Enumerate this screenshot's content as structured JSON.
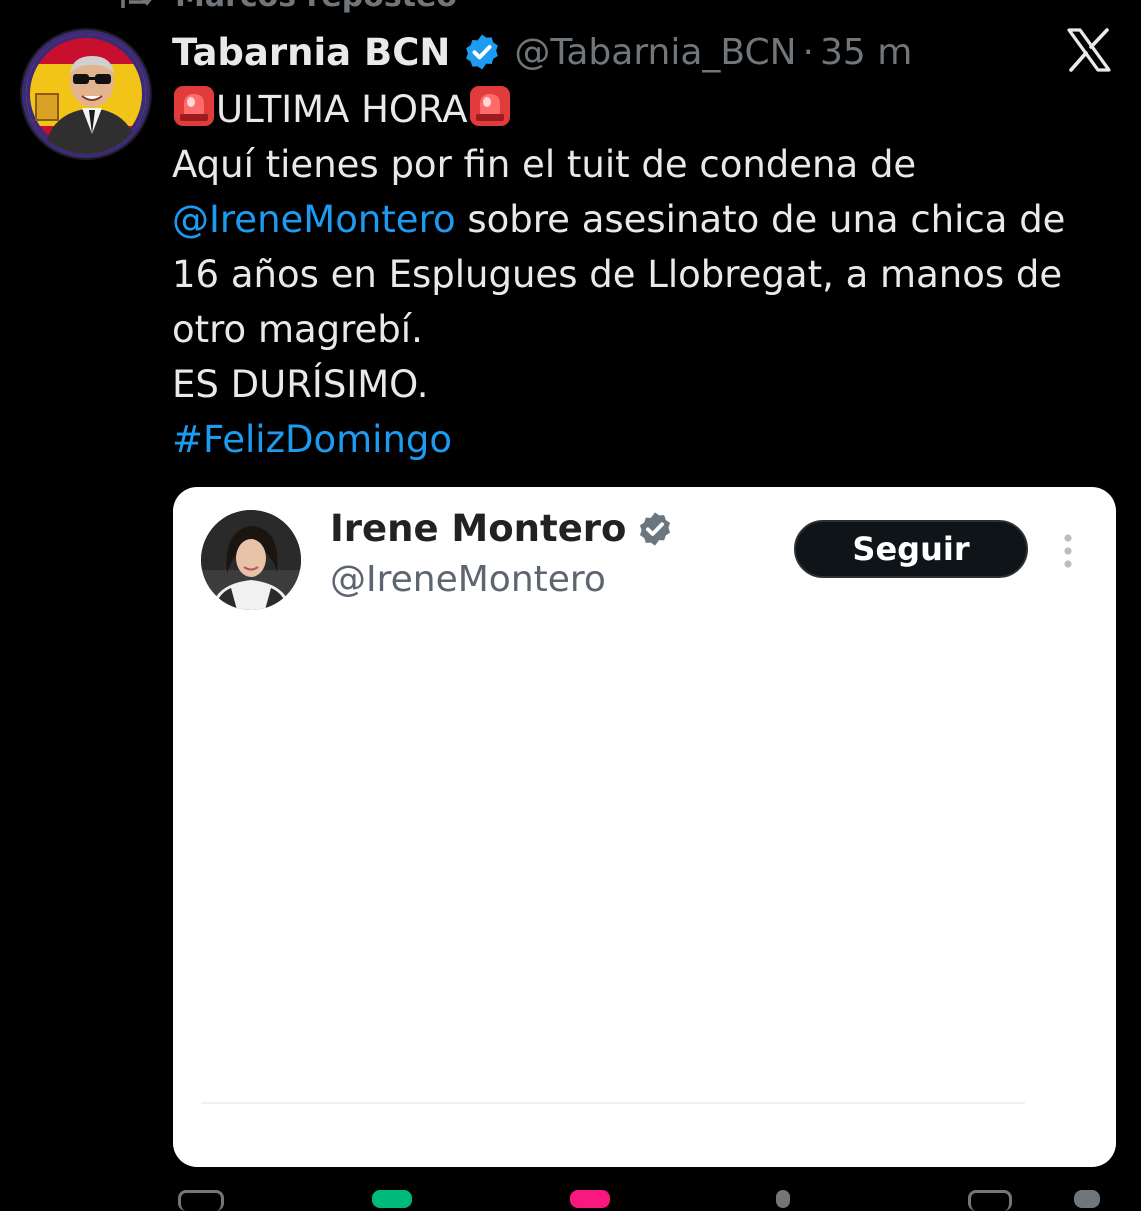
{
  "repost_bar": {
    "text": "Marcos reposteó",
    "icon": "repost-icon"
  },
  "tweet": {
    "author": {
      "display_name": "Tabarnia BCN",
      "verified_icon": "verified-badge-icon",
      "handle": "@Tabarnia_BCN",
      "separator": "·",
      "time": "35 m"
    },
    "brand_icon": "x-logo-icon",
    "body": {
      "line1_text": "ULTIMA HORA",
      "line1_icons": [
        "police-siren-icon",
        "police-siren-icon"
      ],
      "line2": "Aquí tienes por fin el tuit de condena de",
      "mention": "@IreneMontero",
      "line3_rest": " sobre asesinato de una chica de",
      "line4": "16 años en Esplugues de Llobregat, a manos de",
      "line5": "otro magrebí.",
      "line6": "ES DURÍSIMO.",
      "hashtag": "#FelizDomingo"
    },
    "embedded_card": {
      "name": "Irene Montero",
      "verified_icon": "verified-badge-gray-icon",
      "handle": "@IreneMontero",
      "follow_label": "Seguir",
      "more_icon": "more-vertical-icon",
      "body_text": ""
    }
  },
  "colors": {
    "background": "#000000",
    "text": "#e7e9ea",
    "muted": "#71767b",
    "link": "#1d9bf0",
    "verified": "#1d9bf0",
    "card_background": "#ffffff",
    "follow_button": "#0f1419"
  }
}
